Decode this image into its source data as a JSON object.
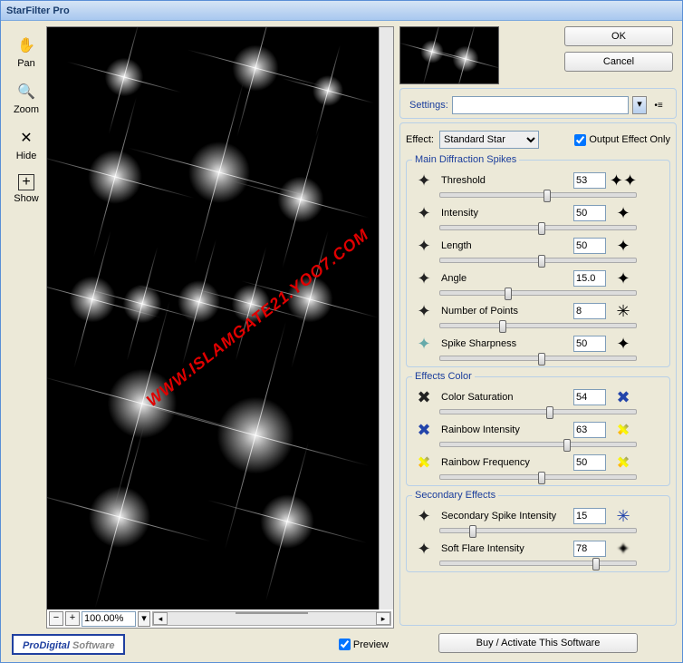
{
  "window": {
    "title": "StarFilter Pro"
  },
  "toolbar": {
    "pan": "Pan",
    "zoom": "Zoom",
    "hide": "Hide",
    "show": "Show"
  },
  "zoom_value": "100.00%",
  "logo": {
    "a": "ProDigital",
    "b": " Software"
  },
  "preview_label": "Preview",
  "buttons": {
    "ok": "OK",
    "cancel": "Cancel",
    "buy": "Buy / Activate This Software"
  },
  "settings_label": "Settings:",
  "effect": {
    "label": "Effect:",
    "selected": "Standard Star",
    "output_only": "Output Effect Only"
  },
  "groups": {
    "main": "Main Diffraction Spikes",
    "color": "Effects Color",
    "secondary": "Secondary Effects"
  },
  "params": {
    "threshold": {
      "label": "Threshold",
      "value": "53"
    },
    "intensity": {
      "label": "Intensity",
      "value": "50"
    },
    "length": {
      "label": "Length",
      "value": "50"
    },
    "angle": {
      "label": "Angle",
      "value": "15.0"
    },
    "points": {
      "label": "Number of Points",
      "value": "8"
    },
    "sharpness": {
      "label": "Spike Sharpness",
      "value": "50"
    },
    "saturation": {
      "label": "Color Saturation",
      "value": "54"
    },
    "rainbow_int": {
      "label": "Rainbow Intensity",
      "value": "63"
    },
    "rainbow_freq": {
      "label": "Rainbow Frequency",
      "value": "50"
    },
    "sec_spike": {
      "label": "Secondary Spike Intensity",
      "value": "15"
    },
    "soft_flare": {
      "label": "Soft Flare Intensity",
      "value": "78"
    }
  },
  "watermark": "WWW.ISLAMGATE21.YOO7.COM"
}
